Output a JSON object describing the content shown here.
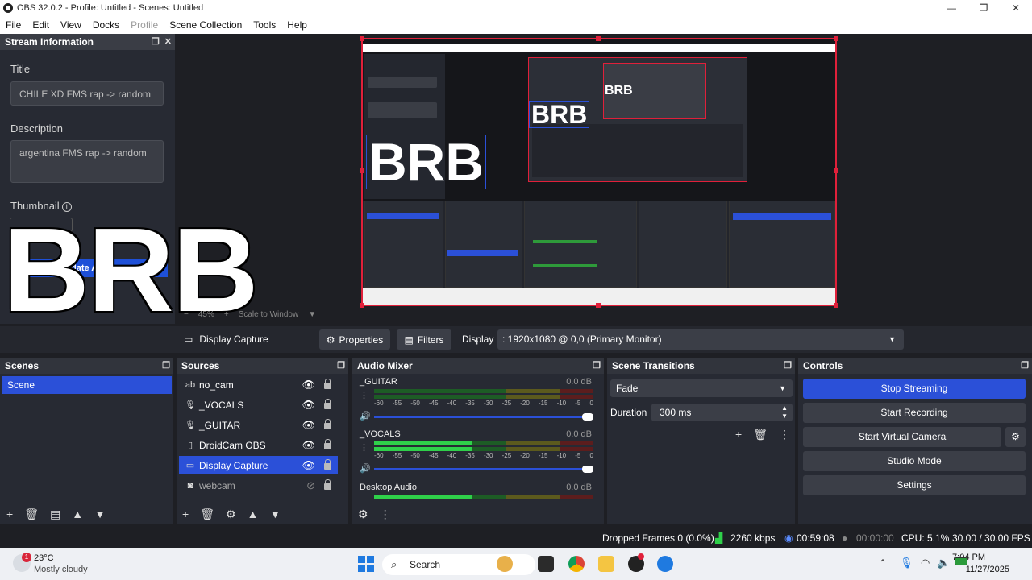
{
  "window": {
    "title": "OBS 32.0.2 - Profile: Untitled - Scenes: Untitled",
    "minimize": "—",
    "maximize": "❐",
    "close": "✕"
  },
  "menu": [
    "File",
    "Edit",
    "View",
    "Docks",
    "Profile",
    "Scene Collection",
    "Tools",
    "Help"
  ],
  "stream_info": {
    "header": "Stream Information",
    "title_label": "Title",
    "title_value": "CHILE XD FMS  rap -> random",
    "description_label": "Description",
    "description_value": "argentina FMS  rap -> random",
    "thumbnail_label": "Thumbnail",
    "overlay_text": "BRB",
    "update_button": "date A"
  },
  "preview": {
    "brb_text": "BRB",
    "zoom": "45%",
    "scale_mode": "Scale to Window"
  },
  "source_bar": {
    "selected_source": "Display Capture",
    "properties": "Properties",
    "filters": "Filters",
    "display_label": "Display",
    "display_value": ": 1920x1080 @ 0,0 (Primary Monitor)"
  },
  "scenes": {
    "header": "Scenes",
    "items": [
      "Scene"
    ]
  },
  "sources": {
    "header": "Sources",
    "items": [
      {
        "name": "no_cam",
        "icon": "text-icon"
      },
      {
        "name": "_VOCALS",
        "icon": "microphone-icon"
      },
      {
        "name": "_GUITAR",
        "icon": "microphone-icon"
      },
      {
        "name": "DroidCam OBS",
        "icon": "file-icon"
      },
      {
        "name": "Display Capture",
        "icon": "monitor-icon",
        "selected": true
      },
      {
        "name": "webcam",
        "icon": "camera-icon",
        "hidden": true
      }
    ]
  },
  "audio_mixer": {
    "header": "Audio Mixer",
    "ticks": [
      "-60",
      "-55",
      "-50",
      "-45",
      "-40",
      "-35",
      "-30",
      "-25",
      "-20",
      "-15",
      "-10",
      "-5",
      "0"
    ],
    "channels": [
      {
        "name": "_GUITAR",
        "db": "0.0 dB",
        "level": 0.0
      },
      {
        "name": "_VOCALS",
        "db": "0.0 dB",
        "level": 0.45
      },
      {
        "name": "Desktop Audio",
        "db": "0.0 dB",
        "level": 0.45
      }
    ]
  },
  "scene_transitions": {
    "header": "Scene Transitions",
    "transition": "Fade",
    "duration_label": "Duration",
    "duration_value": "300 ms"
  },
  "controls": {
    "header": "Controls",
    "buttons": [
      "Stop Streaming",
      "Start Recording",
      "Start Virtual Camera",
      "Studio Mode",
      "Settings"
    ]
  },
  "status": {
    "dropped_frames": "Dropped Frames 0 (0.0%)",
    "bitrate": "2260 kbps",
    "stream_time": "00:59:08",
    "record_time": "00:00:00",
    "cpu": "CPU: 5.1%",
    "fps": "30.00 / 30.00 FPS"
  },
  "taskbar": {
    "temperature": "23°C",
    "weather": "Mostly cloudy",
    "weather_badge": "1",
    "search": "Search",
    "time": "7:04 PM",
    "date": "11/27/2025"
  },
  "colors": {
    "accent": "#2b50d8",
    "panel": "#272a33",
    "record_red": "#e0203a"
  }
}
